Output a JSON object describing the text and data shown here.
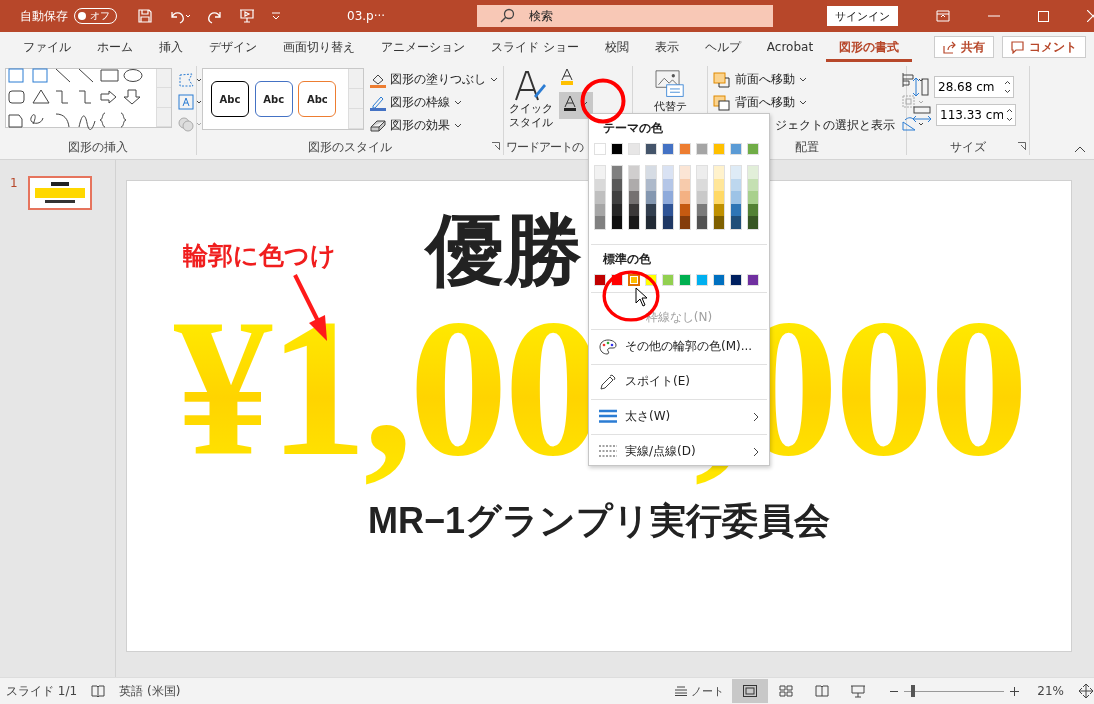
{
  "title_bar": {
    "autosave_label": "自動保存",
    "autosave": {
      "label": "オフ",
      "on": false
    },
    "filename": "03.p···",
    "search_placeholder": "検索",
    "sign_in": "サインイン"
  },
  "tabs": [
    {
      "label": "ファイル",
      "selected": false
    },
    {
      "label": "ホーム",
      "selected": false
    },
    {
      "label": "挿入",
      "selected": false
    },
    {
      "label": "デザイン",
      "selected": false
    },
    {
      "label": "画面切り替え",
      "selected": false
    },
    {
      "label": "アニメーション",
      "selected": false
    },
    {
      "label": "スライド ショー",
      "selected": false
    },
    {
      "label": "校閲",
      "selected": false
    },
    {
      "label": "表示",
      "selected": false
    },
    {
      "label": "ヘルプ",
      "selected": false
    },
    {
      "label": "Acrobat",
      "selected": false
    },
    {
      "label": "図形の書式",
      "selected": true
    }
  ],
  "share": "共有",
  "comment": "コメント",
  "ribbon": {
    "shape_insert": {
      "label": "図形の挿入"
    },
    "shape_styles": {
      "label": "図形のスタイル",
      "presets": [
        {
          "label": "Abc",
          "color": "#000000"
        },
        {
          "label": "Abc",
          "color": "#4472c4"
        },
        {
          "label": "Abc",
          "color": "#ed7d31"
        }
      ],
      "commands": [
        {
          "label": "図形の塗りつぶし",
          "kind": "fill"
        },
        {
          "label": "図形の枠線",
          "kind": "outline"
        },
        {
          "label": "図形の効果",
          "kind": "effect"
        }
      ]
    },
    "wordart": {
      "label": "ワードアートの",
      "quick_style": [
        "クイック",
        "スタイル"
      ]
    },
    "alt_text": "代替テ",
    "arrange": {
      "label": "配置",
      "commands": [
        "前面へ移動",
        "背面へ移動",
        "ジェクトの選択と表示"
      ]
    },
    "size": {
      "label": "サイズ",
      "height": "28.68 cm",
      "width": "113.33 cm"
    }
  },
  "thumbnails": [
    {
      "number": "1",
      "selected": true
    }
  ],
  "slide": {
    "heading": "優勝",
    "callout": "輪郭に色つけ",
    "amount": "¥1,000,000",
    "organizer": "MR−1グランプリ実行委員会"
  },
  "outline_menu": {
    "theme_header": "テーマの色",
    "theme_colors": [
      {
        "color": "#ffffff",
        "selected": false
      },
      {
        "color": "#000000",
        "selected": false
      },
      {
        "color": "#e7e6e6",
        "selected": false
      },
      {
        "color": "#44546a",
        "selected": false
      },
      {
        "color": "#4472c4",
        "selected": false
      },
      {
        "color": "#ed7d31",
        "selected": false
      },
      {
        "color": "#a5a5a5",
        "selected": false
      },
      {
        "color": "#ffc000",
        "selected": false
      },
      {
        "color": "#5b9bd5",
        "selected": false
      },
      {
        "color": "#70ad47",
        "selected": false
      }
    ],
    "shade_columns": [
      [
        {
          "color": "#f2f2f2",
          "selected": false
        },
        {
          "color": "#d9d9d9",
          "selected": false
        },
        {
          "color": "#bfbfbf",
          "selected": false
        },
        {
          "color": "#a6a6a6",
          "selected": false
        },
        {
          "color": "#808080",
          "selected": false
        }
      ],
      [
        {
          "color": "#7f7f7f",
          "selected": false
        },
        {
          "color": "#595959",
          "selected": false
        },
        {
          "color": "#404040",
          "selected": false
        },
        {
          "color": "#262626",
          "selected": false
        },
        {
          "color": "#0d0d0d",
          "selected": false
        }
      ],
      [
        {
          "color": "#d0cece",
          "selected": false
        },
        {
          "color": "#aeabab",
          "selected": false
        },
        {
          "color": "#757171",
          "selected": false
        },
        {
          "color": "#3b3838",
          "selected": false
        },
        {
          "color": "#181717",
          "selected": false
        }
      ],
      [
        {
          "color": "#d6dce4",
          "selected": false
        },
        {
          "color": "#adb9ca",
          "selected": false
        },
        {
          "color": "#8497b0",
          "selected": false
        },
        {
          "color": "#333f4f",
          "selected": false
        },
        {
          "color": "#222a35",
          "selected": false
        }
      ],
      [
        {
          "color": "#d9e2f3",
          "selected": false
        },
        {
          "color": "#b4c6e7",
          "selected": false
        },
        {
          "color": "#8eaadb",
          "selected": false
        },
        {
          "color": "#2f5496",
          "selected": false
        },
        {
          "color": "#1f3864",
          "selected": false
        }
      ],
      [
        {
          "color": "#fbe5d5",
          "selected": false
        },
        {
          "color": "#f7cbac",
          "selected": false
        },
        {
          "color": "#f4b183",
          "selected": false
        },
        {
          "color": "#c55a11",
          "selected": false
        },
        {
          "color": "#843c0b",
          "selected": false
        }
      ],
      [
        {
          "color": "#ededed",
          "selected": false
        },
        {
          "color": "#dbdbdb",
          "selected": false
        },
        {
          "color": "#c9c9c9",
          "selected": false
        },
        {
          "color": "#7b7b7b",
          "selected": false
        },
        {
          "color": "#525252",
          "selected": false
        }
      ],
      [
        {
          "color": "#fff2cc",
          "selected": false
        },
        {
          "color": "#ffe699",
          "selected": false
        },
        {
          "color": "#ffd966",
          "selected": false
        },
        {
          "color": "#bf9000",
          "selected": false
        },
        {
          "color": "#7f6000",
          "selected": false
        }
      ],
      [
        {
          "color": "#deebf6",
          "selected": false
        },
        {
          "color": "#bdd7ee",
          "selected": false
        },
        {
          "color": "#9dc3e6",
          "selected": false
        },
        {
          "color": "#2e75b5",
          "selected": false
        },
        {
          "color": "#1f4e79",
          "selected": false
        }
      ],
      [
        {
          "color": "#e2efd9",
          "selected": false
        },
        {
          "color": "#c5e0b3",
          "selected": false
        },
        {
          "color": "#a8d08d",
          "selected": false
        },
        {
          "color": "#538135",
          "selected": false
        },
        {
          "color": "#375623",
          "selected": false
        }
      ]
    ],
    "standard_header": "標準の色",
    "standard_colors": [
      {
        "color": "#c00000",
        "selected": false
      },
      {
        "color": "#ff0000",
        "selected": false
      },
      {
        "color": "#ffc000",
        "selected": true
      },
      {
        "color": "#ffff00",
        "selected": false
      },
      {
        "color": "#92d050",
        "selected": false
      },
      {
        "color": "#00b050",
        "selected": false
      },
      {
        "color": "#00b0f0",
        "selected": false
      },
      {
        "color": "#0070c0",
        "selected": false
      },
      {
        "color": "#002060",
        "selected": false
      },
      {
        "color": "#7030a0",
        "selected": false
      }
    ],
    "items": [
      {
        "label": "枠線なし(N)",
        "kind": "none",
        "disabled": true,
        "submenu": false
      },
      {
        "label": "その他の輪郭の色(M)...",
        "kind": "palette",
        "disabled": false,
        "submenu": false
      },
      {
        "label": "スポイト(E)",
        "kind": "eyedropper",
        "disabled": false,
        "submenu": false
      },
      {
        "label": "太さ(W)",
        "kind": "weight",
        "disabled": false,
        "submenu": true
      },
      {
        "label": "実線/点線(D)",
        "kind": "dash",
        "disabled": false,
        "submenu": true
      }
    ]
  },
  "status_bar": {
    "slide": "スライド 1/1",
    "language": "英語 (米国)",
    "notes": "ノート",
    "views": [
      {
        "kind": "normal",
        "selected": true
      },
      {
        "kind": "sorter",
        "selected": false
      },
      {
        "kind": "reading",
        "selected": false
      },
      {
        "kind": "presenter",
        "selected": false
      }
    ],
    "zoom": {
      "level": 0.07,
      "value": "21%"
    }
  }
}
